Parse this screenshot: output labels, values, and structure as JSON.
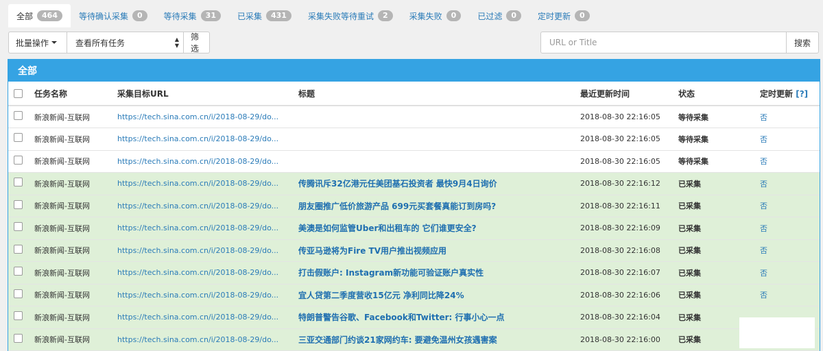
{
  "tabs": [
    {
      "label": "全部",
      "count": "464",
      "active": true
    },
    {
      "label": "等待确认采集",
      "count": "0"
    },
    {
      "label": "等待采集",
      "count": "31"
    },
    {
      "label": "已采集",
      "count": "431"
    },
    {
      "label": "采集失败等待重试",
      "count": "2"
    },
    {
      "label": "采集失败",
      "count": "0"
    },
    {
      "label": "已过滤",
      "count": "0"
    },
    {
      "label": "定时更新",
      "count": "0"
    }
  ],
  "toolbar": {
    "batch_label": "批量操作",
    "select_value": "查看所有任务",
    "filter_label": "筛选"
  },
  "search": {
    "placeholder": "URL or Title",
    "button_label": "搜索"
  },
  "panel": {
    "heading": "全部"
  },
  "table": {
    "columns": {
      "name": "任务名称",
      "url": "采集目标URL",
      "title": "标题",
      "updated": "最近更新时间",
      "status": "状态",
      "schedule": "定时更新",
      "help": "[?]"
    },
    "rows": [
      {
        "name": "新浪新闻-互联网",
        "url": "https://tech.sina.com.cn/i/2018-08-29/do...",
        "title": "",
        "updated": "2018-08-30 22:16:05",
        "status": "等待采集",
        "schedule": "否",
        "done": false
      },
      {
        "name": "新浪新闻-互联网",
        "url": "https://tech.sina.com.cn/i/2018-08-29/do...",
        "title": "",
        "updated": "2018-08-30 22:16:05",
        "status": "等待采集",
        "schedule": "否",
        "done": false
      },
      {
        "name": "新浪新闻-互联网",
        "url": "https://tech.sina.com.cn/i/2018-08-29/do...",
        "title": "",
        "updated": "2018-08-30 22:16:05",
        "status": "等待采集",
        "schedule": "否",
        "done": false
      },
      {
        "name": "新浪新闻-互联网",
        "url": "https://tech.sina.com.cn/i/2018-08-29/do...",
        "title": "传腾讯斥32亿港元任美团基石投资者 最快9月4日询价",
        "updated": "2018-08-30 22:16:12",
        "status": "已采集",
        "schedule": "否",
        "done": true
      },
      {
        "name": "新浪新闻-互联网",
        "url": "https://tech.sina.com.cn/i/2018-08-29/do...",
        "title": "朋友圈推广低价旅游产品 699元买套餐真能订到房吗?",
        "updated": "2018-08-30 22:16:11",
        "status": "已采集",
        "schedule": "否",
        "done": true
      },
      {
        "name": "新浪新闻-互联网",
        "url": "https://tech.sina.com.cn/i/2018-08-29/do...",
        "title": "美澳是如何监管Uber和出租车的 它们谁更安全?",
        "updated": "2018-08-30 22:16:09",
        "status": "已采集",
        "schedule": "否",
        "done": true
      },
      {
        "name": "新浪新闻-互联网",
        "url": "https://tech.sina.com.cn/i/2018-08-29/do...",
        "title": "传亚马逊将为Fire TV用户推出视频应用",
        "updated": "2018-08-30 22:16:08",
        "status": "已采集",
        "schedule": "否",
        "done": true
      },
      {
        "name": "新浪新闻-互联网",
        "url": "https://tech.sina.com.cn/i/2018-08-29/do...",
        "title": "打击假账户: Instagram新功能可验证账户真实性",
        "updated": "2018-08-30 22:16:07",
        "status": "已采集",
        "schedule": "否",
        "done": true
      },
      {
        "name": "新浪新闻-互联网",
        "url": "https://tech.sina.com.cn/i/2018-08-29/do...",
        "title": "宜人贷第二季度营收15亿元 净利同比降24%",
        "updated": "2018-08-30 22:16:06",
        "status": "已采集",
        "schedule": "否",
        "done": true
      },
      {
        "name": "新浪新闻-互联网",
        "url": "https://tech.sina.com.cn/i/2018-08-29/do...",
        "title": "特朗普警告谷歌、Facebook和Twitter: 行事小心一点",
        "updated": "2018-08-30 22:16:04",
        "status": "已采集",
        "schedule": "",
        "done": true
      },
      {
        "name": "新浪新闻-互联网",
        "url": "https://tech.sina.com.cn/i/2018-08-29/do...",
        "title": "三亚交通部门约谈21家网约车: 要避免温州女孩遇害案",
        "updated": "2018-08-30 22:16:00",
        "status": "已采集",
        "schedule": "",
        "done": true
      }
    ]
  }
}
